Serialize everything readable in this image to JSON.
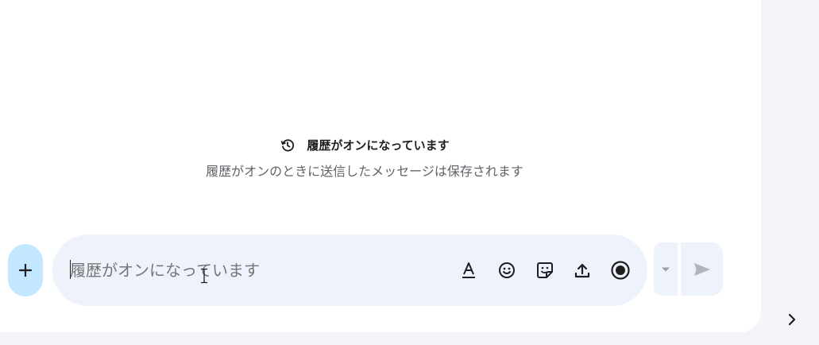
{
  "history": {
    "title": "履歴がオンになっています",
    "subtitle": "履歴がオンのときに送信したメッセージは保存されます",
    "icon": "history-clock-icon"
  },
  "composer": {
    "placeholder": "履歴がオンになっています",
    "value": "",
    "add_icon": "plus-icon",
    "tools": [
      "text-format-icon",
      "emoji-icon",
      "sticker-icon",
      "upload-icon",
      "record-icon"
    ],
    "send_options_icon": "caret-down-icon",
    "send_icon": "send-icon"
  },
  "sidebar": {
    "expand_icon": "chevron-right-icon"
  },
  "colors": {
    "page_bg": "#f3f5f9",
    "panel_bg": "#ffffff",
    "composer_bg": "#eef2fb",
    "plus_button_bg": "#c2e7ff",
    "text_primary": "#1f1f1f",
    "text_secondary": "#5f6368",
    "icon": "#1f1f1f",
    "icon_disabled": "#9aa0a6"
  }
}
